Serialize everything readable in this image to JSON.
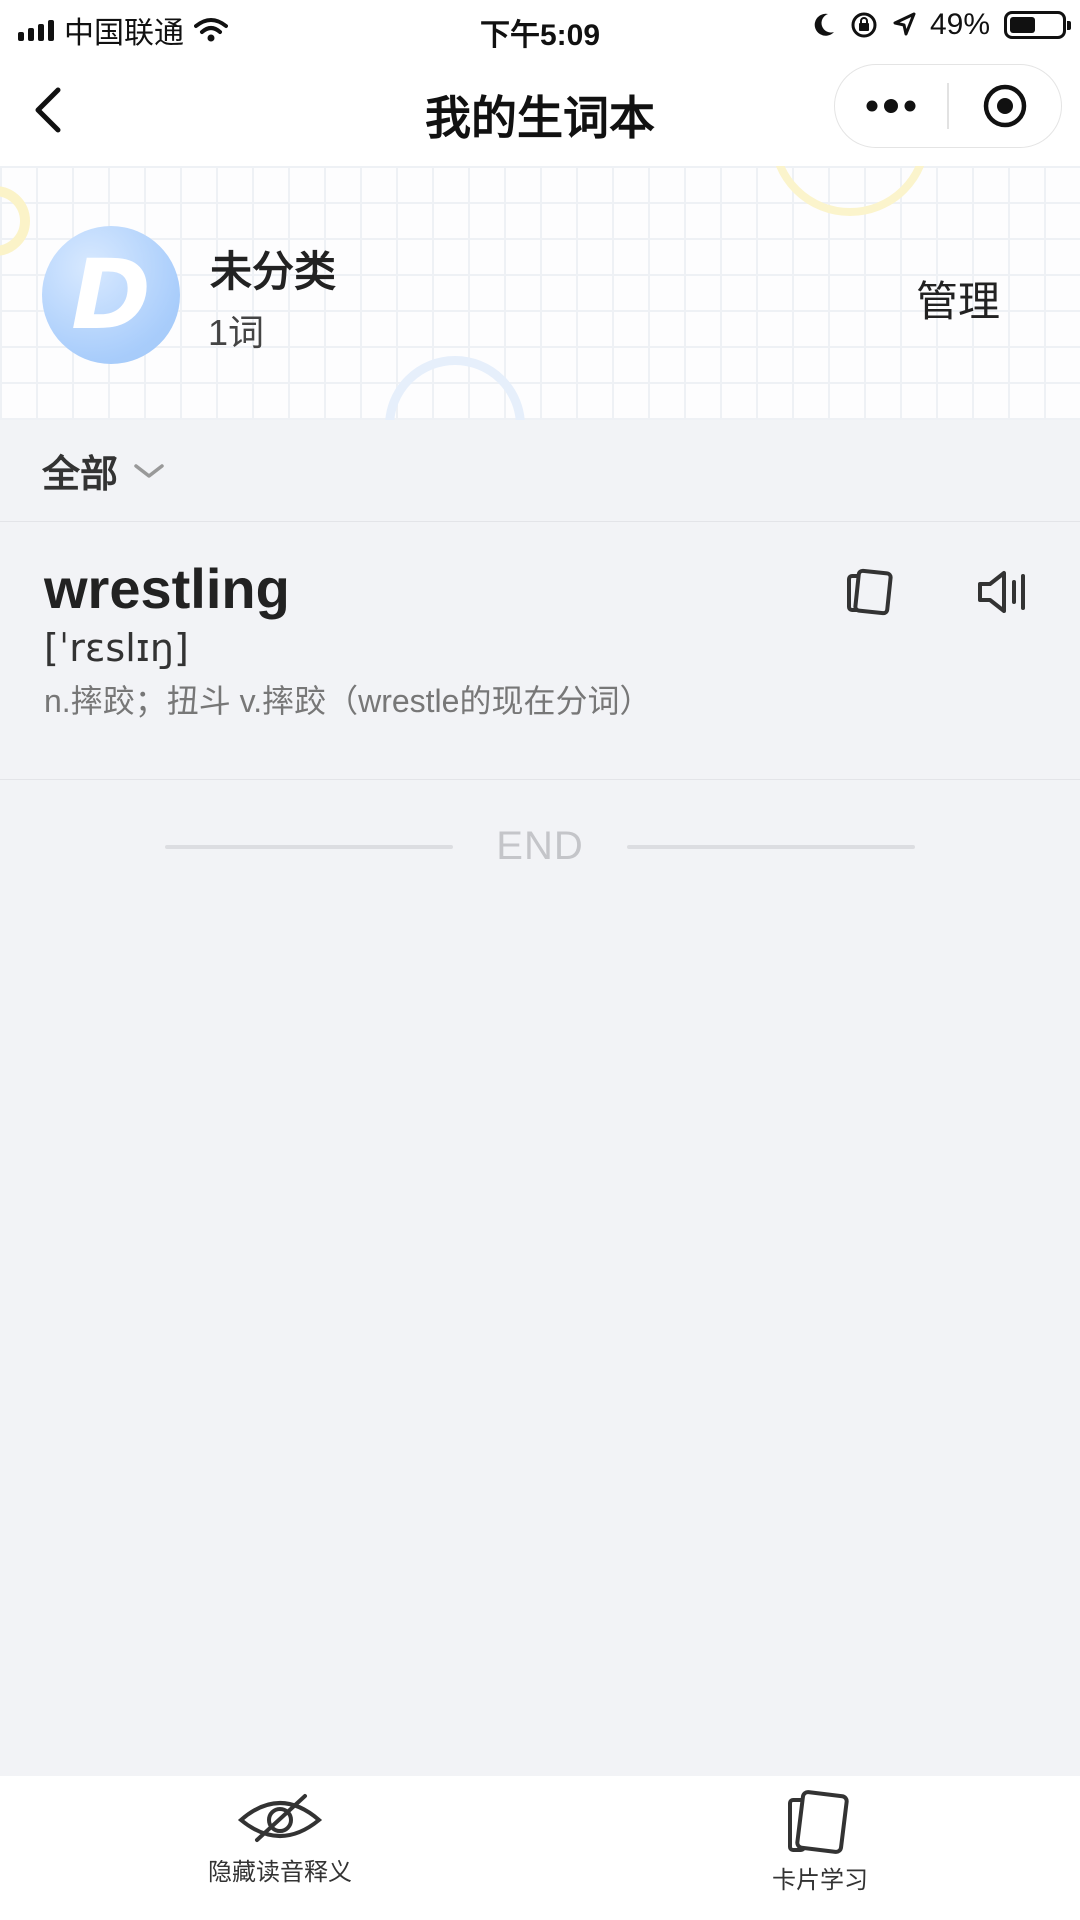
{
  "status_bar": {
    "carrier": "中国联通",
    "time": "下午5:09",
    "battery": "49%",
    "battery_level": 0.49
  },
  "nav": {
    "title": "我的生词本",
    "back_icon": "chevron-left-icon",
    "more_icon": "more-dots-icon",
    "close_icon": "target-circle-icon"
  },
  "header": {
    "avatar_letter": "D",
    "category_name": "未分类",
    "word_count": "1词",
    "manage_label": "管理"
  },
  "filter": {
    "label": "全部",
    "icon": "chevron-down-icon"
  },
  "words": [
    {
      "word": "wrestling",
      "phonetic": "[ˈrɛslɪŋ]",
      "meaning": "n.摔跤；扭斗 v.摔跤（wrestle的现在分词）"
    }
  ],
  "end_label": "END",
  "bottom_bar": {
    "hide_label": "隐藏读音释义",
    "card_label": "卡片学习"
  },
  "colors": {
    "background": "#f2f3f6",
    "avatar_blue": "#a9cdfb",
    "text_dark": "#222222",
    "text_muted": "#777777"
  }
}
